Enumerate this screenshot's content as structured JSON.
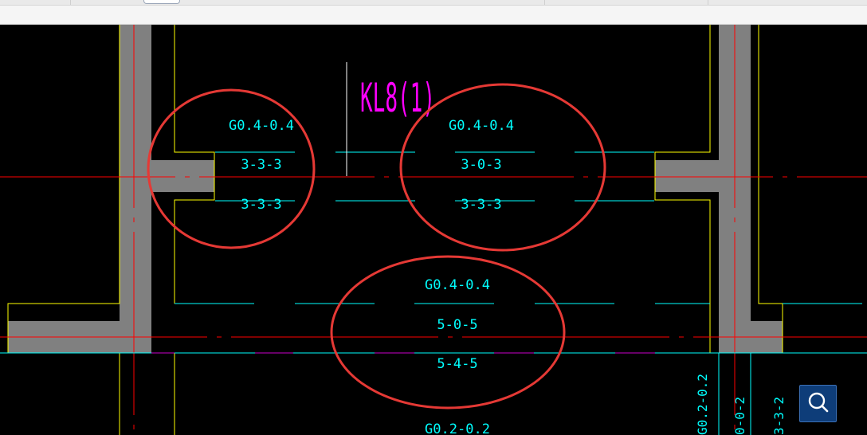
{
  "drawing": {
    "beam_label": "KL8(1)",
    "annotations": {
      "left_top": "G0.4-0.4",
      "left_mid": "3-3-3",
      "left_bot": "3-3-3",
      "center_top": "G0.4-0.4",
      "center_mid": "3-0-3",
      "center_bot": "3-3-3",
      "lower_top": "G0.4-0.4",
      "lower_mid": "5-0-5",
      "lower_bot": "5-4-5",
      "bottom_edge": "G0.2-0.2",
      "vertical_1": "G0.2-0.2",
      "vertical_2": "0-0-2",
      "vertical_3": "3-3-2"
    }
  },
  "colors": {
    "background": "#000000",
    "wall_fill": "#808080",
    "column_outline": "#ffff00",
    "axis_line": "#ff0000",
    "rebar_text": "#00ffff",
    "beam_label": "#ff00ff",
    "markup_circle": "#e53935"
  },
  "controls": {
    "search_icon": "magnifier-icon"
  }
}
